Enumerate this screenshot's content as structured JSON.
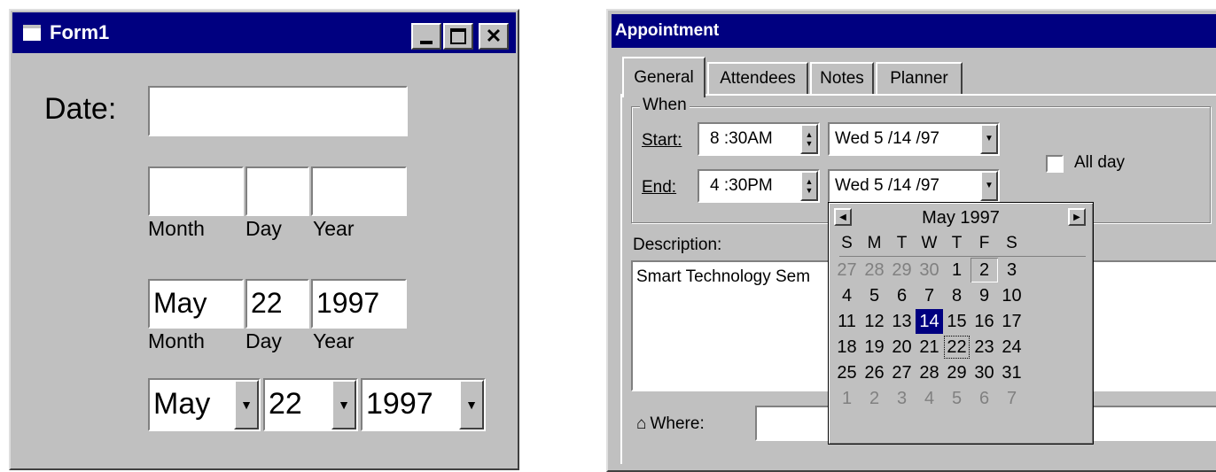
{
  "form1": {
    "title": "Form1",
    "date_label": "Date:",
    "date_value": "",
    "row1": {
      "month": "",
      "day": "",
      "year": ""
    },
    "row1_labels": {
      "month": "Month",
      "day": "Day",
      "year": "Year"
    },
    "row2": {
      "month": "May",
      "day": "22",
      "year": "1997"
    },
    "row2_labels": {
      "month": "Month",
      "day": "Day",
      "year": "Year"
    },
    "row3": {
      "month": "May",
      "day": "22",
      "year": "1997"
    }
  },
  "appointment": {
    "title": "Appointment",
    "tabs": [
      "General",
      "Attendees",
      "Notes",
      "Planner"
    ],
    "group_label": "When",
    "start_label": "Start:",
    "start_time": "8 :30AM",
    "start_date": "Wed  5  /14 /97",
    "end_label": "End:",
    "end_time": "4 :30PM",
    "end_date": "Wed  5  /14 /97",
    "all_day_label": "All day",
    "all_day_checked": false,
    "description_label": "Description:",
    "description_value": "Smart Technology Sem",
    "where_label": "Where:",
    "where_value": ""
  },
  "calendar": {
    "month_label": "May 1997",
    "weekdays": [
      "S",
      "M",
      "T",
      "W",
      "T",
      "F",
      "S"
    ],
    "weeks": [
      [
        "27",
        "28",
        "29",
        "30",
        "1",
        "2",
        "3"
      ],
      [
        "4",
        "5",
        "6",
        "7",
        "8",
        "9",
        "10"
      ],
      [
        "11",
        "12",
        "13",
        "14",
        "15",
        "16",
        "17"
      ],
      [
        "18",
        "19",
        "20",
        "21",
        "22",
        "23",
        "24"
      ],
      [
        "25",
        "26",
        "27",
        "28",
        "29",
        "30",
        "31"
      ],
      [
        "1",
        "2",
        "3",
        "4",
        "5",
        "6",
        "7"
      ]
    ],
    "selected_day": "14",
    "today_day": "22",
    "focused_day": "2"
  },
  "colors": {
    "window": "#c0c0c0",
    "titlebar": "#000080",
    "selected": "#000080",
    "disabled_text": "#808080"
  },
  "icons": {
    "form_icon": "app-window-icon",
    "where_icon": "house-icon"
  }
}
